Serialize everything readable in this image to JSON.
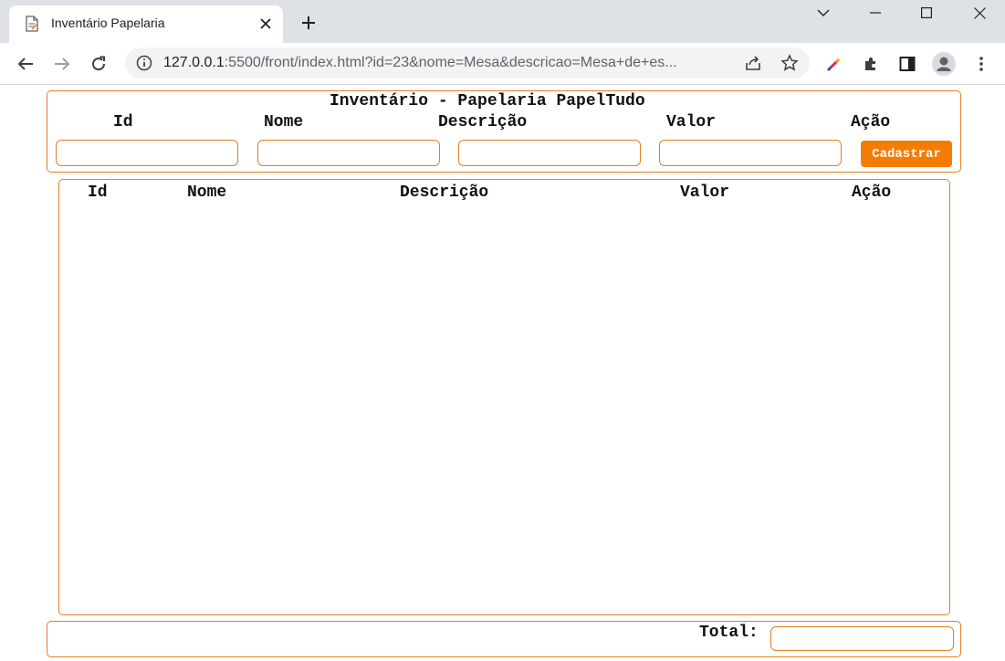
{
  "browser": {
    "tab_title": "Inventário Papelaria",
    "url_host": "127.0.0.1",
    "url_rest": ":5500/front/index.html?id=23&nome=Mesa&descricao=Mesa+de+es...",
    "icons": [
      "page-icon",
      "close-icon",
      "plus-icon",
      "chevron-down-icon",
      "minimize-icon",
      "maximize-icon",
      "window-close-icon",
      "back-icon",
      "forward-icon",
      "reload-icon",
      "info-icon",
      "share-icon",
      "star-icon",
      "eyedropper-icon",
      "extensions-icon",
      "sidepanel-icon",
      "profile-icon",
      "menu-icon"
    ]
  },
  "header": {
    "title": "Inventário - Papelaria PapelTudo",
    "labels": {
      "id": "Id",
      "nome": "Nome",
      "descricao": "Descrição",
      "valor": "Valor",
      "acao": "Ação"
    },
    "button_label": "Cadastrar",
    "fields": {
      "id": "",
      "nome": "",
      "descricao": "",
      "valor": ""
    }
  },
  "table": {
    "columns": {
      "id": "Id",
      "nome": "Nome",
      "descricao": "Descrição",
      "valor": "Valor",
      "acao": "Ação"
    },
    "rows": []
  },
  "footer": {
    "total_label": "Total:",
    "total_value": ""
  },
  "colors": {
    "accent": "#e67e22",
    "button": "#f57c00",
    "chrome": "#dee1e6"
  }
}
